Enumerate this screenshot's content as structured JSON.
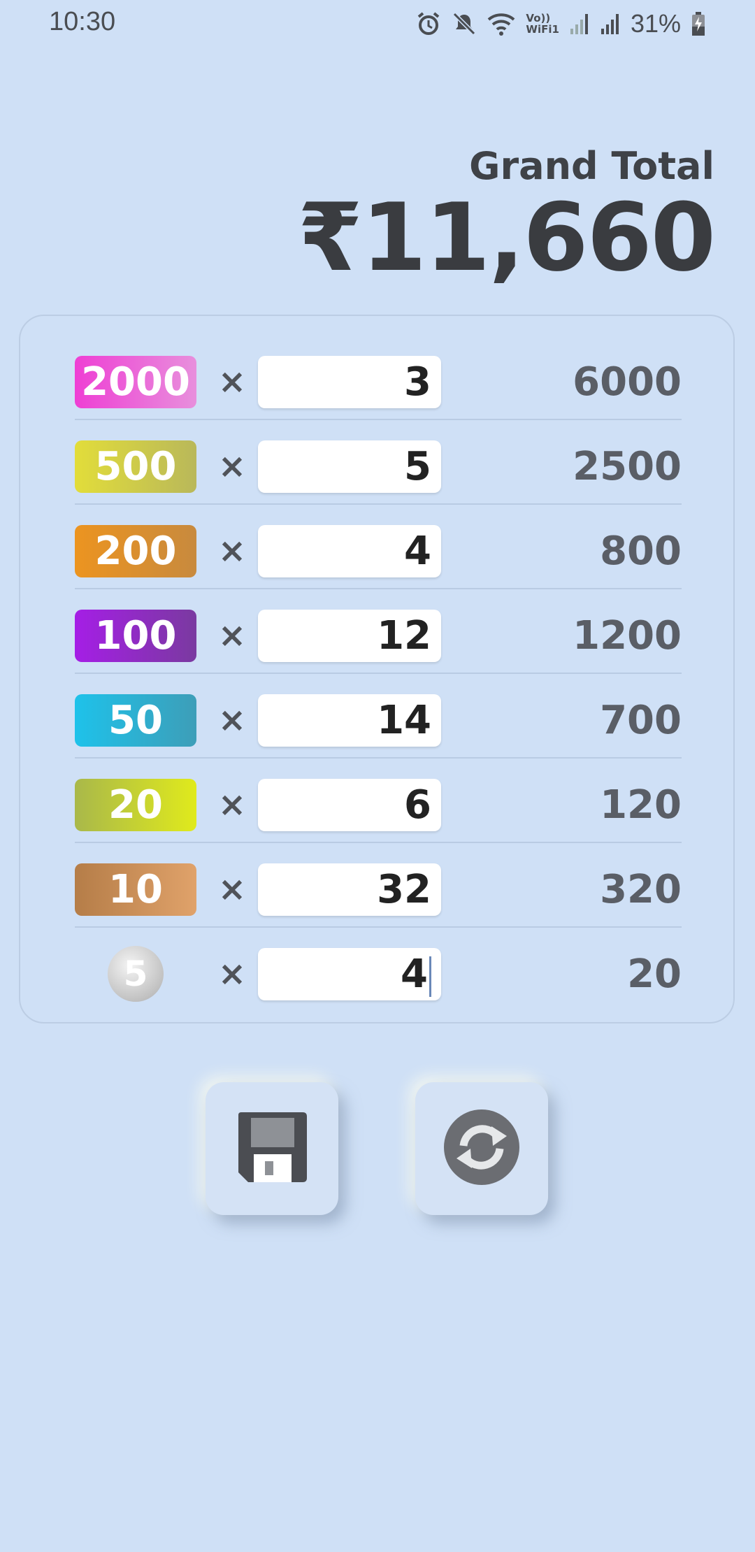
{
  "status_bar": {
    "time": "10:30",
    "battery_percent": "31%",
    "wifi_label_top": "Vo))",
    "wifi_label_bottom": "WiFi1",
    "icons": [
      "alarm-icon",
      "mute-icon",
      "wifi-icon",
      "signal-icon",
      "signal-icon",
      "battery-charging-icon"
    ]
  },
  "grand_total": {
    "label": "Grand Total",
    "value": "₹11,660"
  },
  "denominations": [
    {
      "label": "2000",
      "quantity": "3",
      "amount": "6000",
      "colors": [
        "#ee3fd4",
        "#e88fdc"
      ]
    },
    {
      "label": "500",
      "quantity": "5",
      "amount": "2500",
      "colors": [
        "#e2dd3a",
        "#b9b85a"
      ]
    },
    {
      "label": "200",
      "quantity": "4",
      "amount": "800",
      "colors": [
        "#ec9420",
        "#c88a3e"
      ]
    },
    {
      "label": "100",
      "quantity": "12",
      "amount": "1200",
      "colors": [
        "#a51ee6",
        "#7a3aa0"
      ]
    },
    {
      "label": "50",
      "quantity": "14",
      "amount": "700",
      "colors": [
        "#1ec2ea",
        "#3d9eb8"
      ]
    },
    {
      "label": "20",
      "quantity": "6",
      "amount": "120",
      "colors": [
        "#a9b84a",
        "#e0ea1c"
      ]
    },
    {
      "label": "10",
      "quantity": "32",
      "amount": "320",
      "colors": [
        "#b57d48",
        "#e0a26a"
      ]
    },
    {
      "label": "5",
      "quantity": "4",
      "amount": "20",
      "coin": true
    }
  ],
  "multiply_symbol": "×",
  "buttons": {
    "save_icon": "floppy-disk-icon",
    "reset_icon": "refresh-icon"
  }
}
